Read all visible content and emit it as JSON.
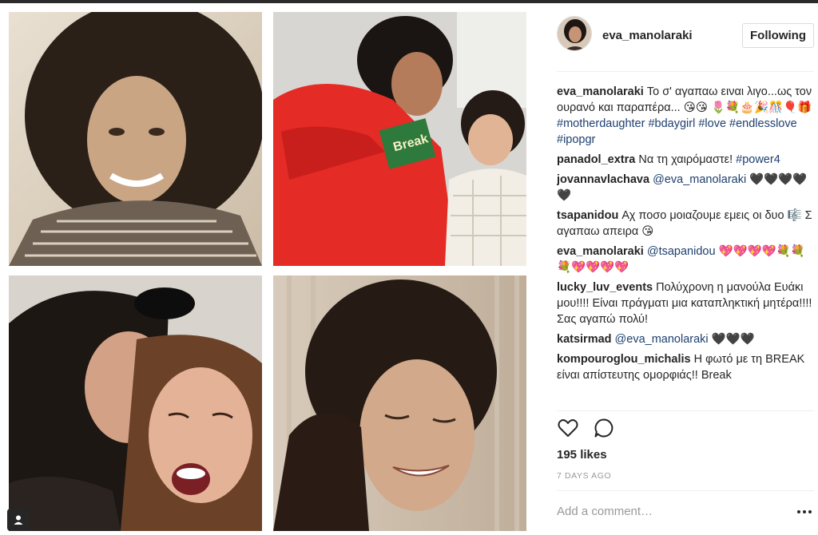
{
  "post": {
    "username": "eva_manolaraki",
    "follow_label": "Following",
    "likes": "195 likes",
    "time_ago": "7 DAYS AGO",
    "add_comment_placeholder": "Add a comment…"
  },
  "comments": [
    {
      "user": "eva_manolaraki",
      "text": "Το σ' αγαπαω ειναι λιγο...ως τον ουρανό και παραπέρα... 😘😘 🌷💐🎂🎉🎊🎈🎁 ",
      "tags": [
        "#motherdaughter",
        "#bdaygirl",
        "#love",
        "#endlesslove",
        "#ipopgr"
      ]
    },
    {
      "user": "panadol_extra",
      "text": "Να τη χαιρόμαστε! ",
      "tags": [
        "#power4"
      ]
    },
    {
      "user": "jovannavlachava",
      "mention": "@eva_manolaraki",
      "text": " 🖤🖤🖤🖤🖤"
    },
    {
      "user": "tsapanidou",
      "text": "Αχ ποσο μοιαζουμε εμεις οι δυο 🎼 Σ αγαπαω απειρα 😘"
    },
    {
      "user": "eva_manolaraki",
      "mention": "@tsapanidou",
      "text": " 💖💖💖💖💐💐💐💖💖💖💖"
    },
    {
      "user": "lucky_luv_events",
      "text": "Πολύχρονη η μανούλα Ευάκι μου!!!! Είναι πράγματι μια καταπληκτική μητέρα!!!! Σας αγαπώ πολύ!"
    },
    {
      "user": "katsirmad",
      "mention": "@eva_manolaraki",
      "text": " 🖤🖤🖤"
    },
    {
      "user": "kompouroglou_michalis",
      "text": "Η φωτό με τη BREAK είναι απίστευτης ομορφιάς!! Break"
    }
  ],
  "photos": {
    "box_label": "Break"
  },
  "icons": {
    "like": "heart-icon",
    "comment": "comment-icon",
    "more": "more-options-icon",
    "tag": "user-tag-icon"
  }
}
